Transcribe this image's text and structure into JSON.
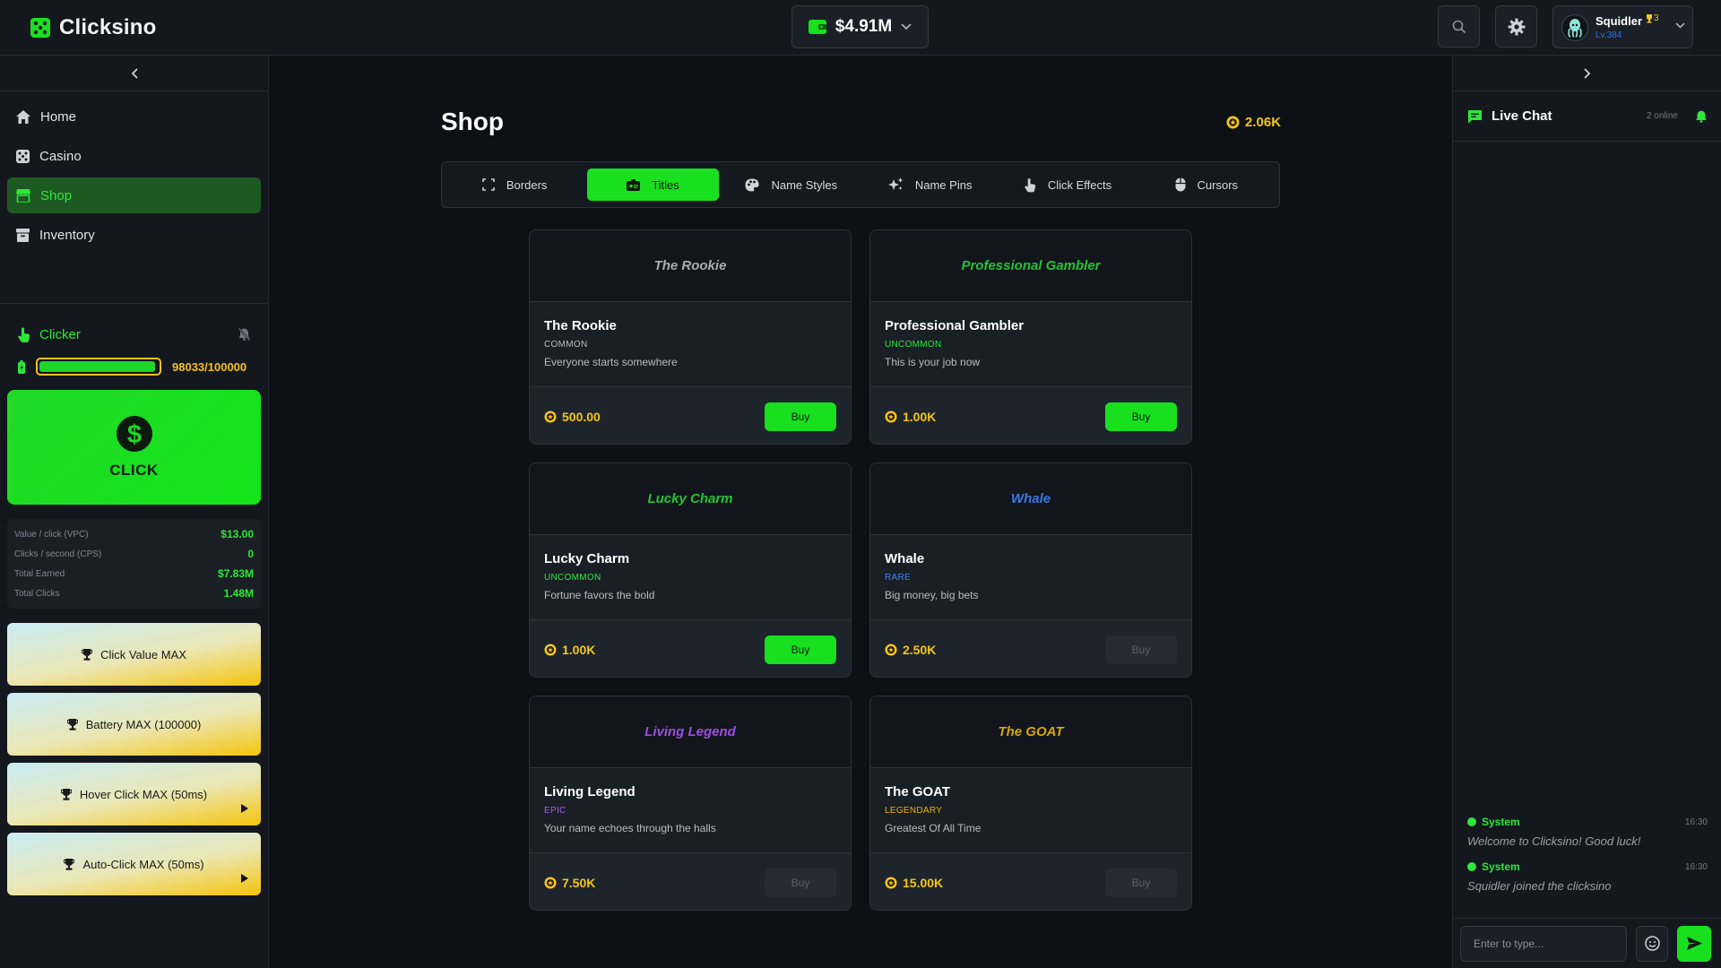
{
  "app": {
    "name": "Clicksino"
  },
  "header": {
    "balance": "$4.91M",
    "user": {
      "name": "Squidler",
      "badge_count": "3",
      "level": "Lv.384"
    }
  },
  "sidebar": {
    "nav": [
      {
        "label": "Home",
        "icon": "home-icon"
      },
      {
        "label": "Casino",
        "icon": "dice-icon"
      },
      {
        "label": "Shop",
        "icon": "shop-icon",
        "active": true
      },
      {
        "label": "Inventory",
        "icon": "archive-icon"
      }
    ],
    "clicker": {
      "title": "Clicker",
      "battery_text": "98033/100000",
      "battery_fraction": 0.98,
      "click_label": "CLICK"
    },
    "stats": [
      {
        "label": "Value / click (VPC)",
        "value": "$13.00"
      },
      {
        "label": "Clicks / second (CPS)",
        "value": "0"
      },
      {
        "label": "Total Earned",
        "value": "$7.83M"
      },
      {
        "label": "Total Clicks",
        "value": "1.48M"
      }
    ],
    "upgrades": [
      {
        "label": "Click Value MAX",
        "has_play": false
      },
      {
        "label": "Battery MAX (100000)",
        "has_play": false
      },
      {
        "label": "Hover Click MAX (50ms)",
        "has_play": true
      },
      {
        "label": "Auto-Click MAX (50ms)",
        "has_play": true
      }
    ]
  },
  "main": {
    "title": "Shop",
    "coins": "2.06K",
    "tabs": [
      {
        "label": "Borders",
        "icon": "frame-icon",
        "active": false
      },
      {
        "label": "Titles",
        "icon": "id-badge-icon",
        "active": true
      },
      {
        "label": "Name Styles",
        "icon": "palette-icon",
        "active": false
      },
      {
        "label": "Name Pins",
        "icon": "sparkles-icon",
        "active": false
      },
      {
        "label": "Click Effects",
        "icon": "pointer-icon",
        "active": false
      },
      {
        "label": "Cursors",
        "icon": "mouse-icon",
        "active": false
      }
    ],
    "items": [
      {
        "preview": "The Rookie",
        "name": "The Rookie",
        "rarity": "COMMON",
        "rarity_color": "#b7bcc3",
        "preview_color": "#a9aeb5",
        "desc": "Everyone starts somewhere",
        "price": "500.00",
        "buy_label": "Buy",
        "buyable": true
      },
      {
        "preview": "Professional Gambler",
        "name": "Professional Gambler",
        "rarity": "UNCOMMON",
        "rarity_color": "#2ee63a",
        "preview_color": "#27c236",
        "desc": "This is your job now",
        "price": "1.00K",
        "buy_label": "Buy",
        "buyable": true
      },
      {
        "preview": "Lucky Charm",
        "name": "Lucky Charm",
        "rarity": "UNCOMMON",
        "rarity_color": "#2ee63a",
        "preview_color": "#27c236",
        "desc": "Fortune favors the bold",
        "price": "1.00K",
        "buy_label": "Buy",
        "buyable": true
      },
      {
        "preview": "Whale",
        "name": "Whale",
        "rarity": "RARE",
        "rarity_color": "#3b82f6",
        "preview_color": "#3b78e0",
        "desc": "Big money, big bets",
        "price": "2.50K",
        "buy_label": "Buy",
        "buyable": false
      },
      {
        "preview": "Living Legend",
        "name": "Living Legend",
        "rarity": "EPIC",
        "rarity_color": "#a855f7",
        "preview_color": "#9b4fe0",
        "desc": "Your name echoes through the halls",
        "price": "7.50K",
        "buy_label": "Buy",
        "buyable": false
      },
      {
        "preview": "The GOAT",
        "name": "The GOAT",
        "rarity": "LEGENDARY",
        "rarity_color": "#eab308",
        "preview_color": "#d4a70e",
        "desc": "Greatest Of All Time",
        "price": "15.00K",
        "buy_label": "Buy",
        "buyable": false
      }
    ]
  },
  "chat": {
    "title": "Live Chat",
    "online": "2 online",
    "messages": [
      {
        "author": "System",
        "time": "16:30",
        "text": "Welcome to Clicksino! Good luck!"
      },
      {
        "author": "System",
        "time": "16:30",
        "text": "Squidler joined the clicksino"
      }
    ],
    "input_placeholder": "Enter to type..."
  },
  "colors": {
    "accent": "#19e01f",
    "gold": "#f5c518",
    "background": "#0d1015",
    "panel": "#14181e"
  }
}
